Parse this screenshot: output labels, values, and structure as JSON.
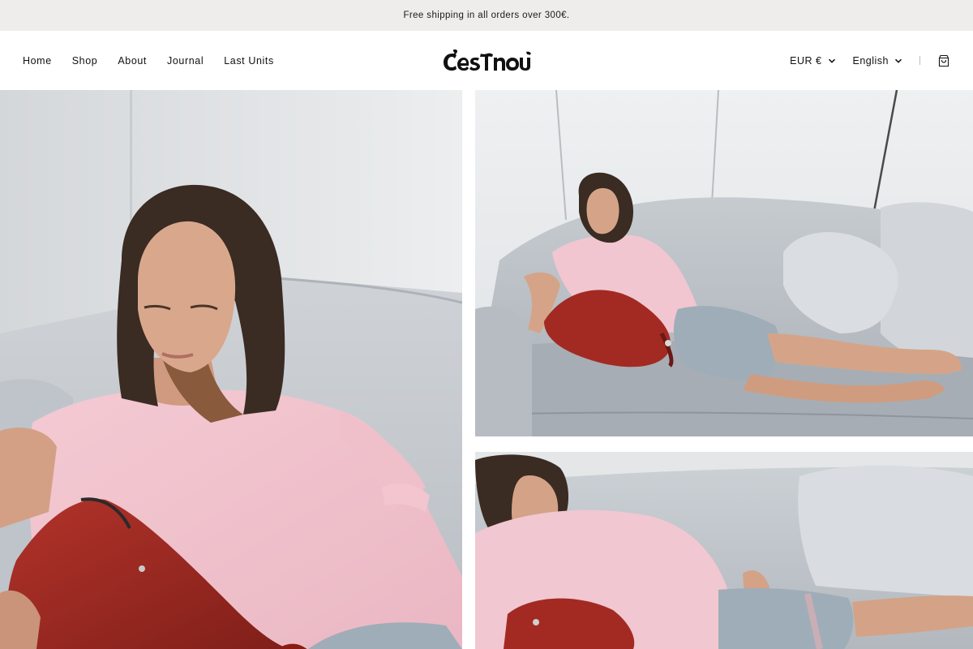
{
  "announcement": {
    "text": "Free shipping in all orders over 300€."
  },
  "nav": {
    "items": [
      {
        "label": "Home"
      },
      {
        "label": "Shop"
      },
      {
        "label": "About"
      },
      {
        "label": "Journal"
      },
      {
        "label": "Last Units"
      }
    ]
  },
  "brand": {
    "logo_text": "C'est nous"
  },
  "tools": {
    "currency": "EUR €",
    "language": "English",
    "cart_icon": "shopping-bag-icon",
    "chevron_icon": "chevron-down-icon"
  },
  "colors": {
    "announcement_bg": "#eeedeb",
    "wall": "#e6e8ea",
    "sofa": "#c9cdd2",
    "tshirt": "#f2c7d1",
    "bag": "#a32a22",
    "hair": "#3a2a22",
    "skin": "#d9a88c",
    "shorts": "#9fadb8"
  }
}
